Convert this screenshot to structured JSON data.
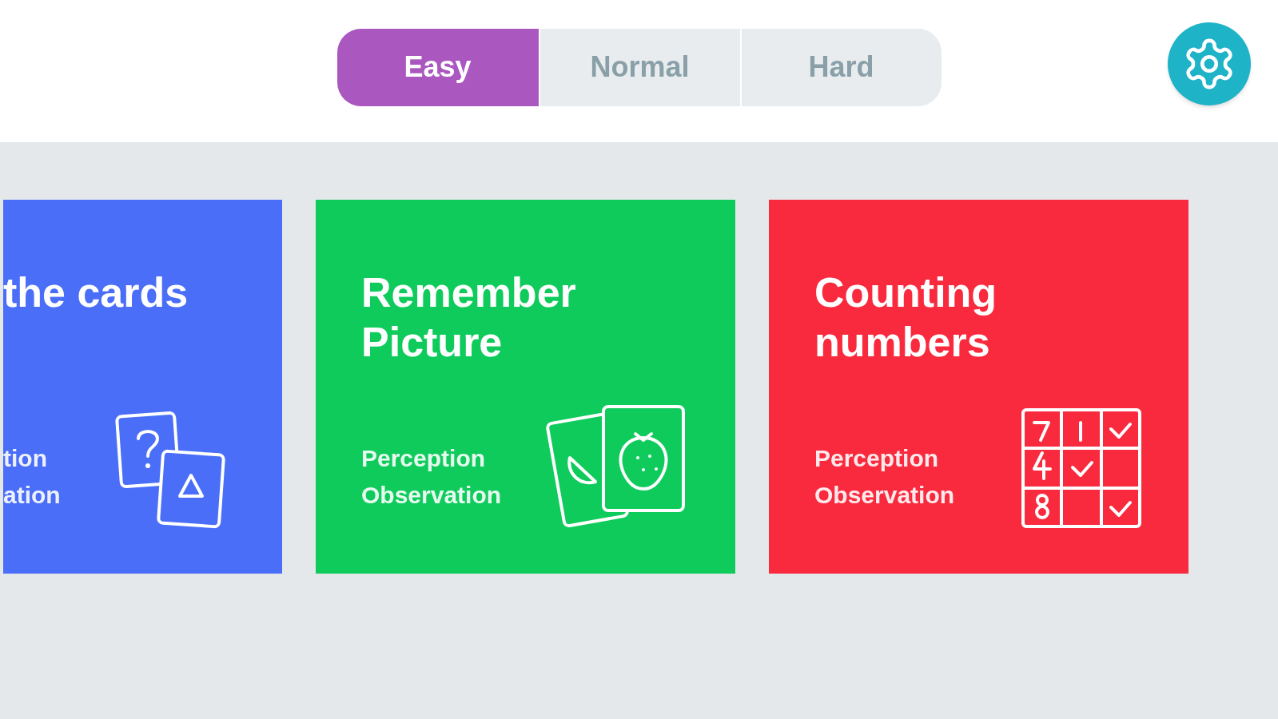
{
  "difficulty_tabs": [
    {
      "label": "Easy",
      "selected": true
    },
    {
      "label": "Normal",
      "selected": false
    },
    {
      "label": "Hard",
      "selected": false
    }
  ],
  "games": [
    {
      "kind": "question-cards",
      "title": "the cards",
      "tags": [
        "tion",
        "ation"
      ],
      "color": "#4a6ef8",
      "cut": true
    },
    {
      "kind": "picture-cards",
      "title": "Remember Picture",
      "tags": [
        "Perception",
        "Observation"
      ],
      "color": "#0ecb5c",
      "cut": false
    },
    {
      "kind": "number-grid",
      "title": "Counting numbers",
      "tags": [
        "Perception",
        "Observation"
      ],
      "color": "#f92a3e",
      "cut": false
    }
  ]
}
